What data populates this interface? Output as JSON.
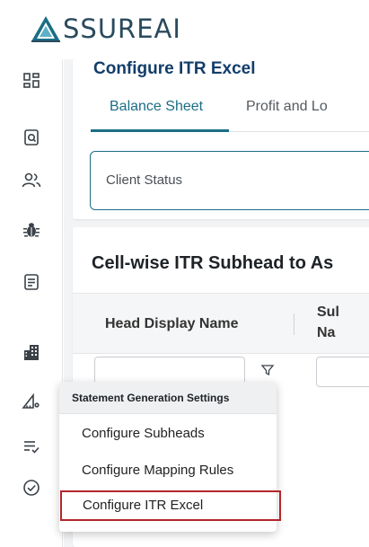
{
  "brand": {
    "logo_text": "SSUREAI",
    "logo_icon": "triangle-a-logo"
  },
  "sidebar": {
    "items": [
      {
        "icon": "dashboard-grid-icon",
        "name": "sidebar-item-dashboard"
      },
      {
        "icon": "document-search-icon",
        "name": "sidebar-item-document-search"
      },
      {
        "icon": "users-icon",
        "name": "sidebar-item-users"
      },
      {
        "icon": "bug-icon",
        "name": "sidebar-item-bug"
      },
      {
        "icon": "form-list-icon",
        "name": "sidebar-item-forms"
      },
      {
        "icon": "buildings-icon",
        "name": "sidebar-item-organizations"
      },
      {
        "icon": "ruler-settings-icon",
        "name": "sidebar-item-statement-generation-settings"
      },
      {
        "icon": "checklist-icon",
        "name": "sidebar-item-checklist"
      },
      {
        "icon": "check-circle-icon",
        "name": "sidebar-item-approvals"
      }
    ]
  },
  "page": {
    "title": "Configure ITR Excel",
    "tabs": [
      {
        "label": "Balance Sheet",
        "active": true
      },
      {
        "label": "Profit and Lo",
        "active": false
      }
    ],
    "client_status_label": "Client Status"
  },
  "section": {
    "title": "Cell-wise ITR Subhead to As",
    "columns": [
      {
        "label": "Head Display Name"
      },
      {
        "label_line1": "Sul",
        "label_line2": "Na"
      }
    ]
  },
  "menu": {
    "header": "Statement Generation Settings",
    "items": [
      {
        "label": "Configure Subheads",
        "selected": false
      },
      {
        "label": "Configure Mapping Rules",
        "selected": false
      },
      {
        "label": "Configure ITR Excel",
        "selected": true
      }
    ]
  },
  "colors": {
    "accent": "#1a6e86",
    "title": "#123d6a",
    "selection_border": "#b3262b",
    "logo": "#2a4a5e"
  }
}
